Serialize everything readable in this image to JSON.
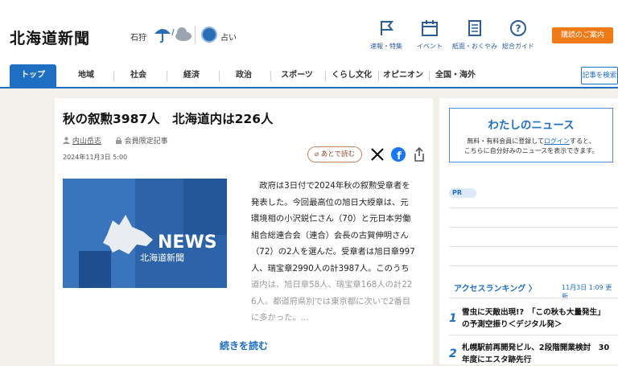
{
  "header": {
    "logo": "北海道新聞",
    "region": "石狩",
    "fortune_label": "占い",
    "nav_icons": [
      {
        "label": "速報・特集",
        "icon": "flag-icon"
      },
      {
        "label": "イベント",
        "icon": "calendar-icon"
      },
      {
        "label": "紙面・おくやみ",
        "icon": "newspaper-icon"
      },
      {
        "label": "総合ガイド",
        "icon": "help-icon"
      }
    ],
    "cta_label": "購読のご案内",
    "accent_color": "#f07a16"
  },
  "nav": {
    "items": [
      "トップ",
      "地域",
      "社会",
      "経済",
      "政治",
      "スポーツ",
      "くらし文化",
      "オピニオン",
      "全国・海外"
    ],
    "search_label": "記事を検索",
    "active_color": "#1e6fc4"
  },
  "article": {
    "title": "秋の叙勲3987人　北海道内は226人",
    "author": "内山岳志",
    "member_label": "会員限定記事",
    "date": "2024年11月3日 5:00",
    "read_later_label": "あとで読む",
    "image_text": "NEWS",
    "image_subtext": "北海道新聞",
    "body_lines": [
      "　政府は3日付で2024年秋の叙勲受章者を",
      "発表した。今回最高位の旭日大綬章は、元",
      "環境相の小沢鋭仁さん（70）と元日本労働",
      "組合総連合会（連合）会長の古賀伸明さん",
      "（72）の2人を選んだ。受章者は旭日章997",
      "人、瑞宝章2990人の計3987人。このうち",
      "道内は、旭日章58人、瑞宝章168人の計22",
      "6人。都道府県別では東京都に次いで2番目",
      "に多かった。..."
    ],
    "read_more_label": "続きを読む"
  },
  "sidebar": {
    "mynews_title": "わたしのニュース",
    "mynews_desc_1": "無料・有料会員に登録して",
    "mynews_login": "ログイン",
    "mynews_desc_2": "すると、",
    "mynews_desc_3": "こちらに自分好みのニュースを表示できます。",
    "pr_label": "PR",
    "ranking_title": "アクセスランキング",
    "ranking_time": "11月3日 1:09 更新",
    "ranking": [
      {
        "num": "1",
        "line1": "雪虫に天敵出現!?　「この秋も大量発生」",
        "line2": "の予測空振り＜デジタル発＞"
      },
      {
        "num": "2",
        "line1": "札幌駅前再開発ビル、2段階開業検討　30",
        "line2": "年度にエスタ跡先行"
      }
    ]
  }
}
